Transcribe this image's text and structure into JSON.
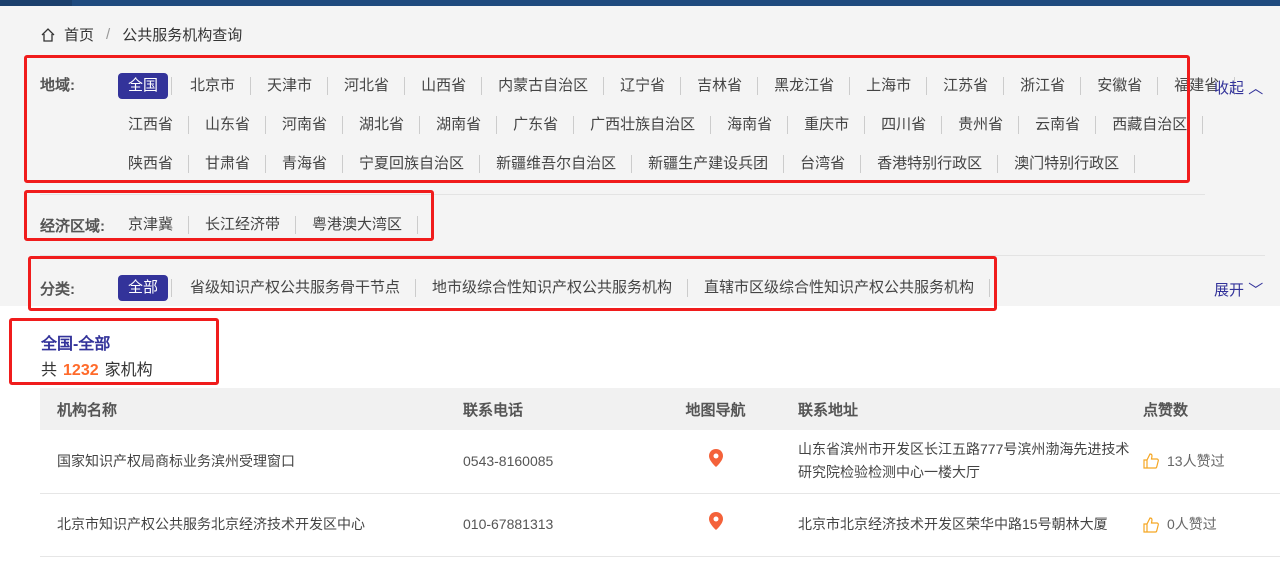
{
  "breadcrumb": {
    "home": "首页",
    "separator": "/",
    "current": "公共服务机构查询"
  },
  "region": {
    "label": "地域:",
    "collapse": "收起",
    "items": [
      [
        "全国",
        "北京市",
        "天津市",
        "河北省",
        "山西省",
        "内蒙古自治区",
        "辽宁省",
        "吉林省",
        "黑龙江省",
        "上海市",
        "江苏省",
        "浙江省",
        "安徽省",
        "福建省"
      ],
      [
        "江西省",
        "山东省",
        "河南省",
        "湖北省",
        "湖南省",
        "广东省",
        "广西壮族自治区",
        "海南省",
        "重庆市",
        "四川省",
        "贵州省",
        "云南省",
        "西藏自治区"
      ],
      [
        "陕西省",
        "甘肃省",
        "青海省",
        "宁夏回族自治区",
        "新疆维吾尔自治区",
        "新疆生产建设兵团",
        "台湾省",
        "香港特别行政区",
        "澳门特别行政区"
      ]
    ],
    "selected": "全国"
  },
  "economic": {
    "label": "经济区域:",
    "items": [
      "京津冀",
      "长江经济带",
      "粤港澳大湾区"
    ]
  },
  "category": {
    "label": "分类:",
    "expand": "展开",
    "items": [
      "全部",
      "省级知识产权公共服务骨干节点",
      "地市级综合性知识产权公共服务机构",
      "直辖市区级综合性知识产权公共服务机构"
    ],
    "selected": "全部"
  },
  "result": {
    "title": "全国-全部",
    "prefix": "共",
    "count": "1232",
    "suffix": "家机构"
  },
  "table": {
    "headers": [
      "机构名称",
      "联系电话",
      "地图导航",
      "联系地址",
      "点赞数"
    ],
    "rows": [
      {
        "name": "国家知识产权局商标业务滨州受理窗口",
        "phone": "0543-8160085",
        "address": "山东省滨州市开发区长江五路777号滨州渤海先进技术研究院检验检测中心一楼大厅",
        "likes": "13人赞过"
      },
      {
        "name": "北京市知识产权公共服务北京经济技术开发区中心",
        "phone": "010-67881313",
        "address": "北京市北京经济技术开发区荣华中路15号朝林大厦",
        "likes": "0人赞过"
      }
    ]
  },
  "colors": {
    "accent": "#33339a",
    "count": "#ff6a2a",
    "pin": "#f4623a",
    "thumb": "#f5a623"
  }
}
